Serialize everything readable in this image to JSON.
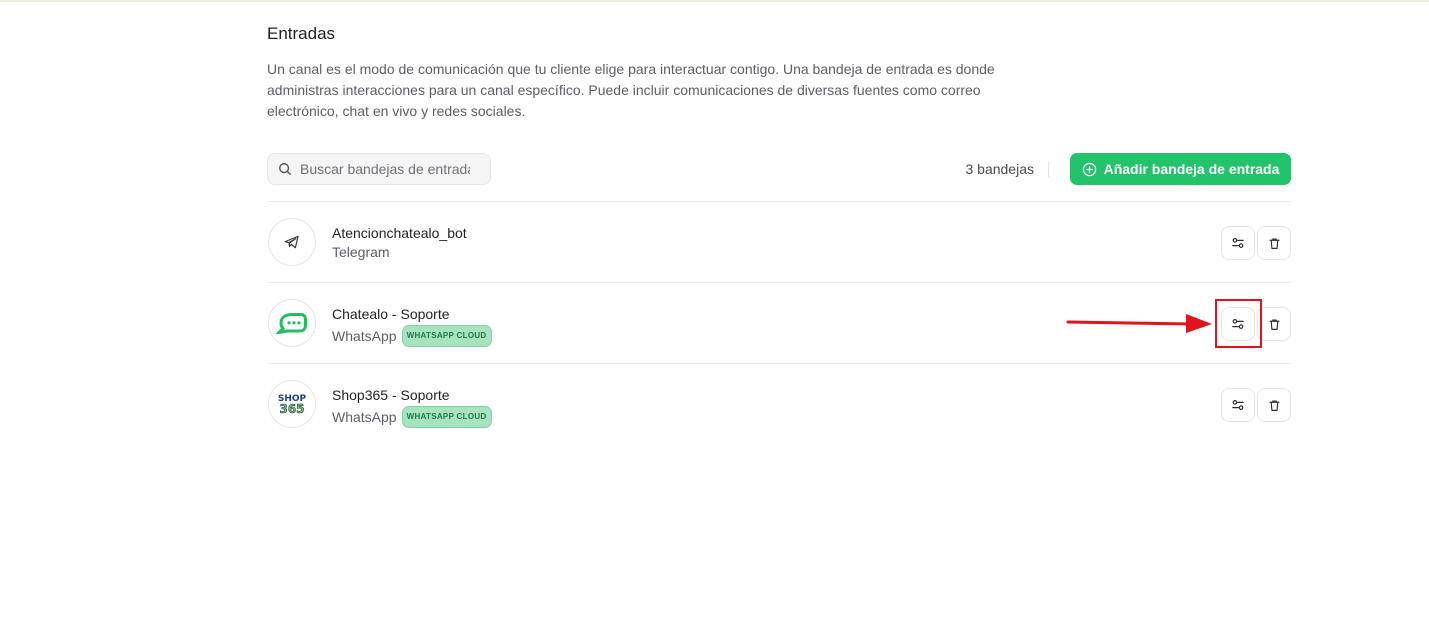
{
  "page": {
    "title": "Entradas",
    "description": "Un canal es el modo de comunicación que tu cliente elige para interactuar contigo. Una bandeja de entrada es donde administras interacciones para un canal específico. Puede incluir comunicaciones de diversas fuentes como correo electrónico, chat en vivo y redes sociales."
  },
  "toolbar": {
    "search_placeholder": "Buscar bandejas de entrada",
    "count_label": "3 bandejas",
    "add_button_label": "Añadir bandeja de entrada"
  },
  "inboxes": [
    {
      "name": "Atencionchatealo_bot",
      "channel": "Telegram",
      "badge": "",
      "icon": "telegram-icon"
    },
    {
      "name": "Chatealo - Soporte",
      "channel": "WhatsApp",
      "badge": "WHATSAPP CLOUD",
      "icon": "chatealo-logo-icon"
    },
    {
      "name": "Shop365 - Soporte",
      "channel": "WhatsApp",
      "badge": "WHATSAPP CLOUD",
      "icon": "shop365-logo-icon"
    }
  ],
  "colors": {
    "accent_green": "#22c36b",
    "badge_bg": "#a8e3c0",
    "annotation_red": "#e0141a"
  }
}
